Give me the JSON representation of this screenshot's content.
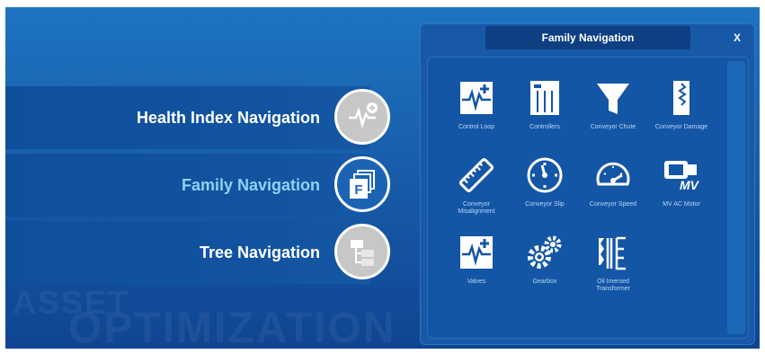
{
  "watermark": {
    "line1": "ASSET",
    "line2": "OPTIMIZATION"
  },
  "nav": {
    "items": [
      {
        "label": "Health Index Navigation",
        "icon": "health-index-icon",
        "active": false
      },
      {
        "label": "Family Navigation",
        "icon": "family-icon",
        "active": true
      },
      {
        "label": "Tree Navigation",
        "icon": "tree-icon",
        "active": false
      }
    ]
  },
  "panel": {
    "title": "Family Navigation",
    "close_label": "X",
    "tiles": [
      {
        "label": "Control Loop",
        "icon": "control-loop-icon"
      },
      {
        "label": "Controllers",
        "icon": "controllers-icon"
      },
      {
        "label": "Conveyor Chute",
        "icon": "conveyor-chute-icon"
      },
      {
        "label": "Conveyor Damage",
        "icon": "conveyor-damage-icon"
      },
      {
        "label": "Conveyor Misalignment",
        "icon": "conveyor-misalignment-icon"
      },
      {
        "label": "Conveyor Slip",
        "icon": "conveyor-slip-icon"
      },
      {
        "label": "Conveyor Speed",
        "icon": "conveyor-speed-icon"
      },
      {
        "label": "MV AC Motor",
        "icon": "mv-ac-motor-icon",
        "badge": "MV"
      },
      {
        "label": "Valves",
        "icon": "valves-icon"
      },
      {
        "label": "Gearbox",
        "icon": "gearbox-icon"
      },
      {
        "label": "Oil Imersed Transformer",
        "icon": "transformer-icon"
      }
    ]
  },
  "colors": {
    "active_nav": "#8fd0f5",
    "background": "#1a63b0",
    "panel": "#1759a7"
  }
}
